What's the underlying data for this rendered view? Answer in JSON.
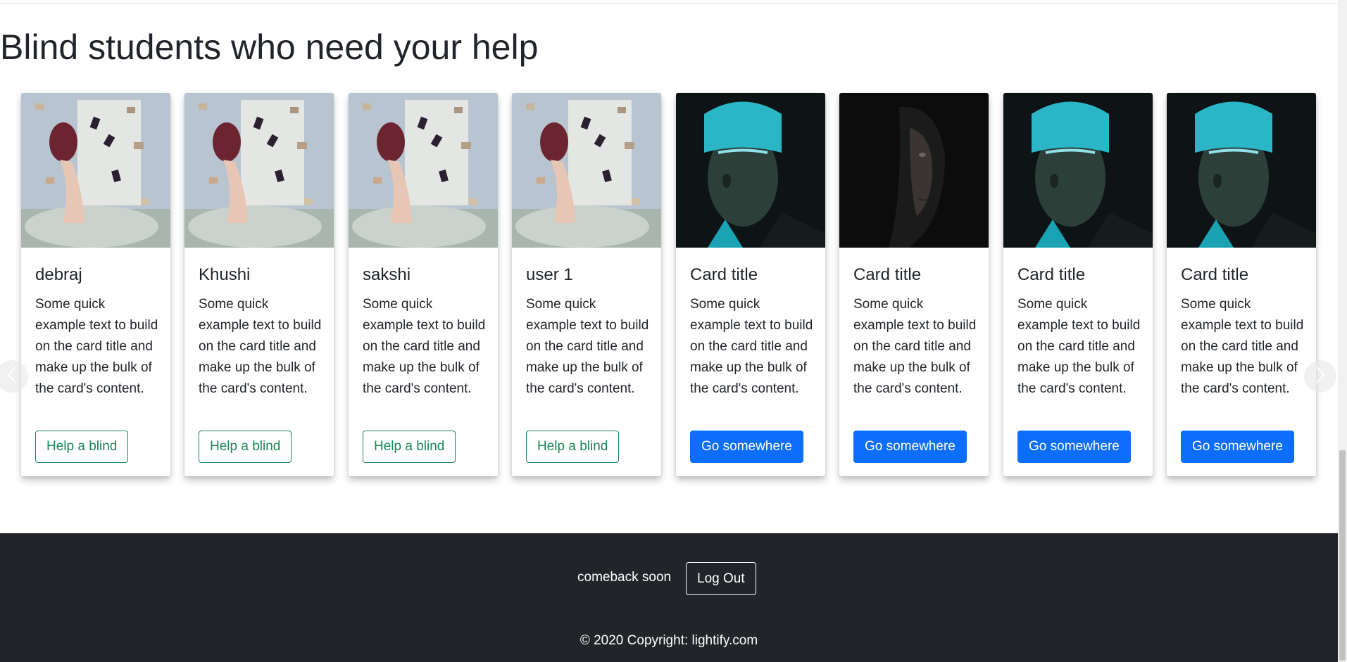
{
  "section": {
    "heading": "Blind students who need your help"
  },
  "cards": [
    {
      "title": "debraj",
      "text": "Some quick example text to build on the card title and make up the bulk of the card's content.",
      "button": "Help a blind",
      "button_style": "outline",
      "image": "girl-with-flying-books"
    },
    {
      "title": "Khushi",
      "text": "Some quick example text to build on the card title and make up the bulk of the card's content.",
      "button": "Help a blind",
      "button_style": "outline",
      "image": "girl-with-flying-books"
    },
    {
      "title": "sakshi",
      "text": "Some quick example text to build on the card title and make up the bulk of the card's content.",
      "button": "Help a blind",
      "button_style": "outline",
      "image": "girl-with-flying-books"
    },
    {
      "title": "user 1",
      "text": "Some quick example text to build on the card title and make up the bulk of the card's content.",
      "button": "Help a blind",
      "button_style": "outline",
      "image": "girl-with-flying-books"
    },
    {
      "title": "Card title",
      "text": "Some quick example text to build on the card title and make up the bulk of the card's content.",
      "button": "Go somewhere",
      "button_style": "primary",
      "image": "person-blindfolded-teal-light"
    },
    {
      "title": "Card title",
      "text": "Some quick example text to build on the card title and make up the bulk of the card's content.",
      "button": "Go somewhere",
      "button_style": "primary",
      "image": "woman-in-shadow"
    },
    {
      "title": "Card title",
      "text": "Some quick example text to build on the card title and make up the bulk of the card's content.",
      "button": "Go somewhere",
      "button_style": "primary",
      "image": "person-blindfolded-teal-light"
    },
    {
      "title": "Card title",
      "text": "Some quick example text to build on the card title and make up the bulk of the card's content.",
      "button": "Go somewhere",
      "button_style": "primary",
      "image": "person-blindfolded-teal-light"
    }
  ],
  "carousel": {
    "prev_icon": "chevron-left-icon",
    "next_icon": "chevron-right-icon"
  },
  "footer": {
    "message": "comeback soon",
    "logout_label": "Log Out",
    "copyright": "© 2020 Copyright: lightify.com"
  },
  "colors": {
    "outline_green": "#198754",
    "primary_blue": "#0d6efd",
    "footer_bg": "#212529"
  }
}
